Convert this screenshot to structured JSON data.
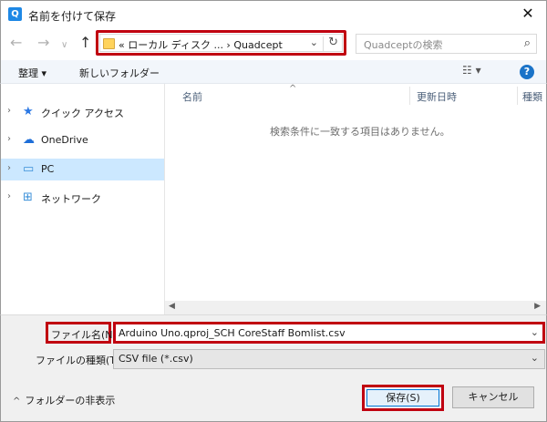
{
  "window": {
    "title": "名前を付けて保存",
    "app_icon_letter": "Q",
    "close_glyph": "✕"
  },
  "nav": {
    "back_icon": "arrow-left-icon",
    "forward_icon": "arrow-right-icon",
    "recent_icon": "chevron-down-icon",
    "up_icon": "arrow-up-icon",
    "back_glyph": "←",
    "forward_glyph": "→",
    "recent_glyph": "∨",
    "up_glyph": "↑"
  },
  "address": {
    "path_text": "«  ローカル ディスク ...   ›   Quadcept",
    "chevron_glyph": "⌄",
    "refresh_glyph": "↻"
  },
  "search": {
    "placeholder": "Quadceptの検索",
    "icon_glyph": "⌕"
  },
  "toolbar": {
    "organize": "整理 ▾",
    "new_folder": "新しいフォルダー",
    "view_glyph": "☷ ▾",
    "help_glyph": "?"
  },
  "sidebar": {
    "items": [
      {
        "label": "クイック アクセス",
        "icon": "star-icon",
        "glyph": "★",
        "color": "#2b78e4",
        "selected": false
      },
      {
        "label": "OneDrive",
        "icon": "cloud-icon",
        "glyph": "☁",
        "color": "#1e6ed8",
        "selected": false
      },
      {
        "label": "PC",
        "icon": "monitor-icon",
        "glyph": "▭",
        "color": "#3a8fd8",
        "selected": true
      },
      {
        "label": "ネットワーク",
        "icon": "network-icon",
        "glyph": "⊞",
        "color": "#3a8fd8",
        "selected": false
      }
    ],
    "chevron_glyph": "›"
  },
  "content": {
    "columns": [
      "名前",
      "更新日時",
      "種類"
    ],
    "sort_glyph": "^",
    "empty_message": "検索条件に一致する項目はありません。"
  },
  "scrollbar": {
    "left_glyph": "◀",
    "right_glyph": "▶"
  },
  "form": {
    "filename_label": "ファイル名(N):",
    "filename_value": "Arduino Uno.qproj_SCH CoreStaff Bomlist.csv",
    "filetype_label": "ファイルの種類(T):",
    "filetype_value": "CSV file (*.csv)",
    "dropdown_glyph": "⌄"
  },
  "footer": {
    "hide_folders": "フォルダーの非表示",
    "hide_caret": "^",
    "save": "保存(S)",
    "cancel": "キャンセル"
  },
  "colors": {
    "highlight": "#c00010",
    "selection": "#cce8ff",
    "accent": "#0078d7"
  }
}
